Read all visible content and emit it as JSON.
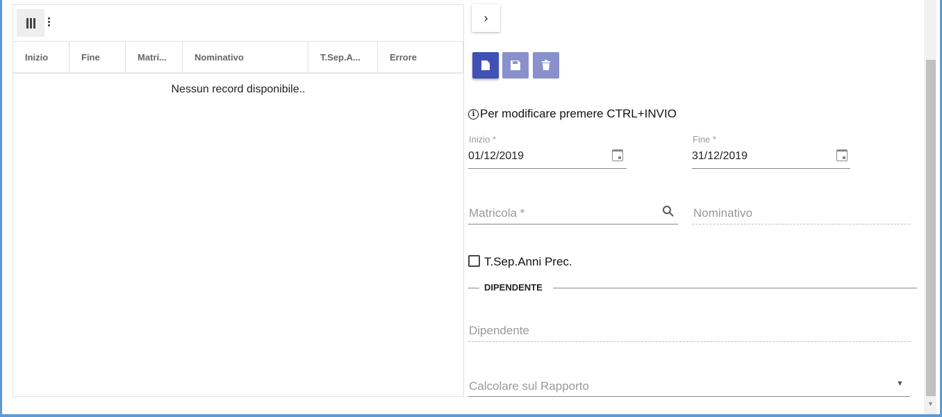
{
  "grid": {
    "columns": [
      "Inizio",
      "Fine",
      "Matri...",
      "Nominativo",
      "T.Sep.A...",
      "Errore"
    ],
    "empty_message": "Nessun record disponibile.."
  },
  "form": {
    "info": "Per modificare premere CTRL+INVIO",
    "inizio": {
      "label": "Inizio *",
      "value": "01/12/2019"
    },
    "fine": {
      "label": "Fine *",
      "value": "31/12/2019"
    },
    "matricola": {
      "placeholder": "Matricola *"
    },
    "nominativo": {
      "placeholder": "Nominativo"
    },
    "tsep": {
      "label": "T.Sep.Anni Prec.",
      "checked": false
    },
    "section": "DIPENDENTE",
    "dipendente": {
      "placeholder": "Dipendente"
    },
    "rapporto": {
      "placeholder": "Calcolare sul Rapporto"
    }
  },
  "colors": {
    "primary": "#3f51b5",
    "primary_disabled": "#8891cc",
    "border": "#5b9bd5"
  }
}
